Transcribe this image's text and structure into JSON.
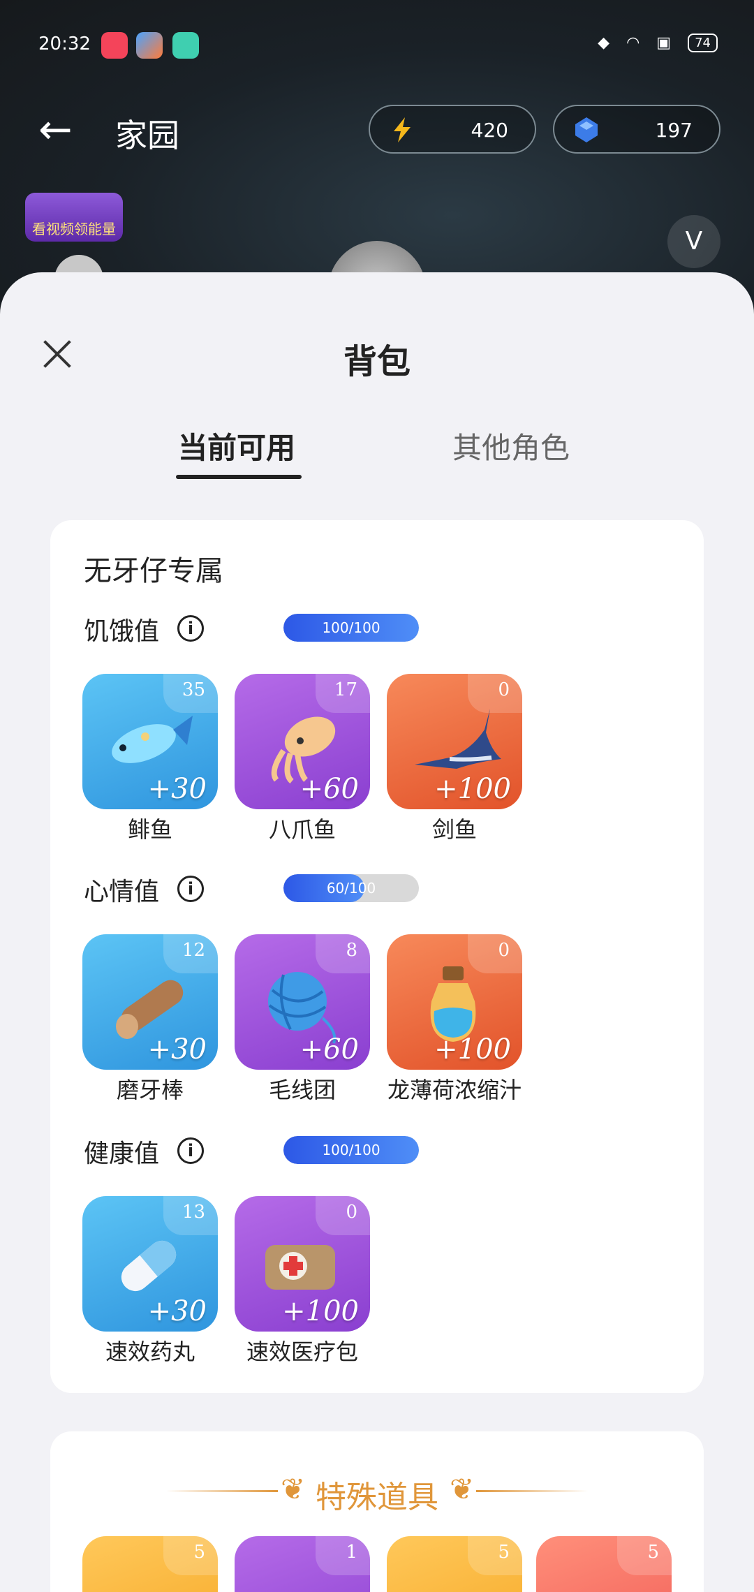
{
  "status_bar": {
    "time": "20:32",
    "battery": "74"
  },
  "nav": {
    "back_glyph": "←",
    "title": "家园"
  },
  "currency": {
    "energy": "420",
    "gems": "197"
  },
  "game": {
    "video_badge": "看视频领能量",
    "vip_glyph": "V"
  },
  "sheet": {
    "title": "背包"
  },
  "tabs": [
    {
      "label": "当前可用"
    },
    {
      "label": "其他角色"
    }
  ],
  "main_card": {
    "title": "无牙仔专属",
    "stats": [
      {
        "label": "饥饿值",
        "progress": "100/100",
        "fraction": 1.0,
        "items": [
          {
            "name": "鲱鱼",
            "count": "35",
            "bonus": "+30",
            "color": "blue",
            "icon": "fish-icon"
          },
          {
            "name": "八爪鱼",
            "count": "17",
            "bonus": "+60",
            "color": "purple",
            "icon": "squid-icon"
          },
          {
            "name": "剑鱼",
            "count": "0",
            "bonus": "+100",
            "color": "orange",
            "icon": "swordfish-icon"
          }
        ]
      },
      {
        "label": "心情值",
        "progress": "60/100",
        "fraction": 0.6,
        "items": [
          {
            "name": "磨牙棒",
            "count": "12",
            "bonus": "+30",
            "color": "blue",
            "icon": "log-icon"
          },
          {
            "name": "毛线团",
            "count": "8",
            "bonus": "+60",
            "color": "purple",
            "icon": "yarn-icon"
          },
          {
            "name": "龙薄荷浓缩汁",
            "count": "0",
            "bonus": "+100",
            "color": "orange",
            "icon": "potion-icon"
          }
        ]
      },
      {
        "label": "健康值",
        "progress": "100/100",
        "fraction": 1.0,
        "items": [
          {
            "name": "速效药丸",
            "count": "13",
            "bonus": "+30",
            "color": "blue",
            "icon": "pill-icon"
          },
          {
            "name": "速效医疗包",
            "count": "0",
            "bonus": "+100",
            "color": "purple",
            "icon": "medkit-icon"
          }
        ]
      }
    ]
  },
  "special_card": {
    "title": "特殊道具",
    "items": [
      {
        "count": "5",
        "color": "gold"
      },
      {
        "count": "1",
        "color": "purple"
      },
      {
        "count": "5",
        "color": "gold"
      },
      {
        "count": "5",
        "color": "pink"
      }
    ]
  }
}
